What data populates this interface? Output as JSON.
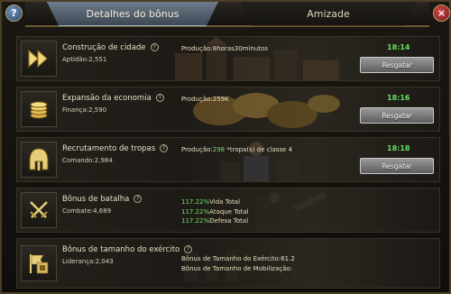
{
  "tabs": {
    "active_label": "Detalhes do bônus",
    "inactive_label": "Amizade"
  },
  "buttons": {
    "help": "?",
    "close": "×"
  },
  "rows": [
    {
      "title": "Construção de cidade",
      "stat": "Aptidão:2,551",
      "production": "Produção:8horas30minutos",
      "timer": "18:14",
      "button": "Resgatar",
      "icon": "fast-forward-icon"
    },
    {
      "title": "Expansão da economia",
      "stat": "Finança:2,590",
      "production": "Produção:259K",
      "timer": "18:16",
      "button": "Resgatar",
      "icon": "coins-icon"
    },
    {
      "title": "Recrutamento de tropas",
      "stat": "Comando:2,984",
      "production_prefix": "Produção:",
      "production_value": "298",
      "production_suffix": " *tropa(s) de classe 4",
      "timer": "18:18",
      "button": "Resgatar",
      "icon": "helmet-icon"
    },
    {
      "title": "Bônus de batalha",
      "stat": "Combate:4,689",
      "bonuses": [
        {
          "value": "117.22%",
          "label": "Vida Total"
        },
        {
          "value": "117.22%",
          "label": "Ataque Total"
        },
        {
          "value": "117.22%",
          "label": "Defesa Total"
        }
      ],
      "icon": "crossed-swords-icon"
    },
    {
      "title": "Bônus de tamanho do exército",
      "stat": "Liderança:2,043",
      "bonus_line1": "Bônus de Tamanho do Exército:61.2",
      "bonus_line2": "Bônus de Tamanho de Mobilização:",
      "icon": "army-flag-icon"
    }
  ],
  "colors": {
    "timer": "#63e05d",
    "bonus_value": "#6fe06b",
    "tab_active": "#5a6877"
  }
}
